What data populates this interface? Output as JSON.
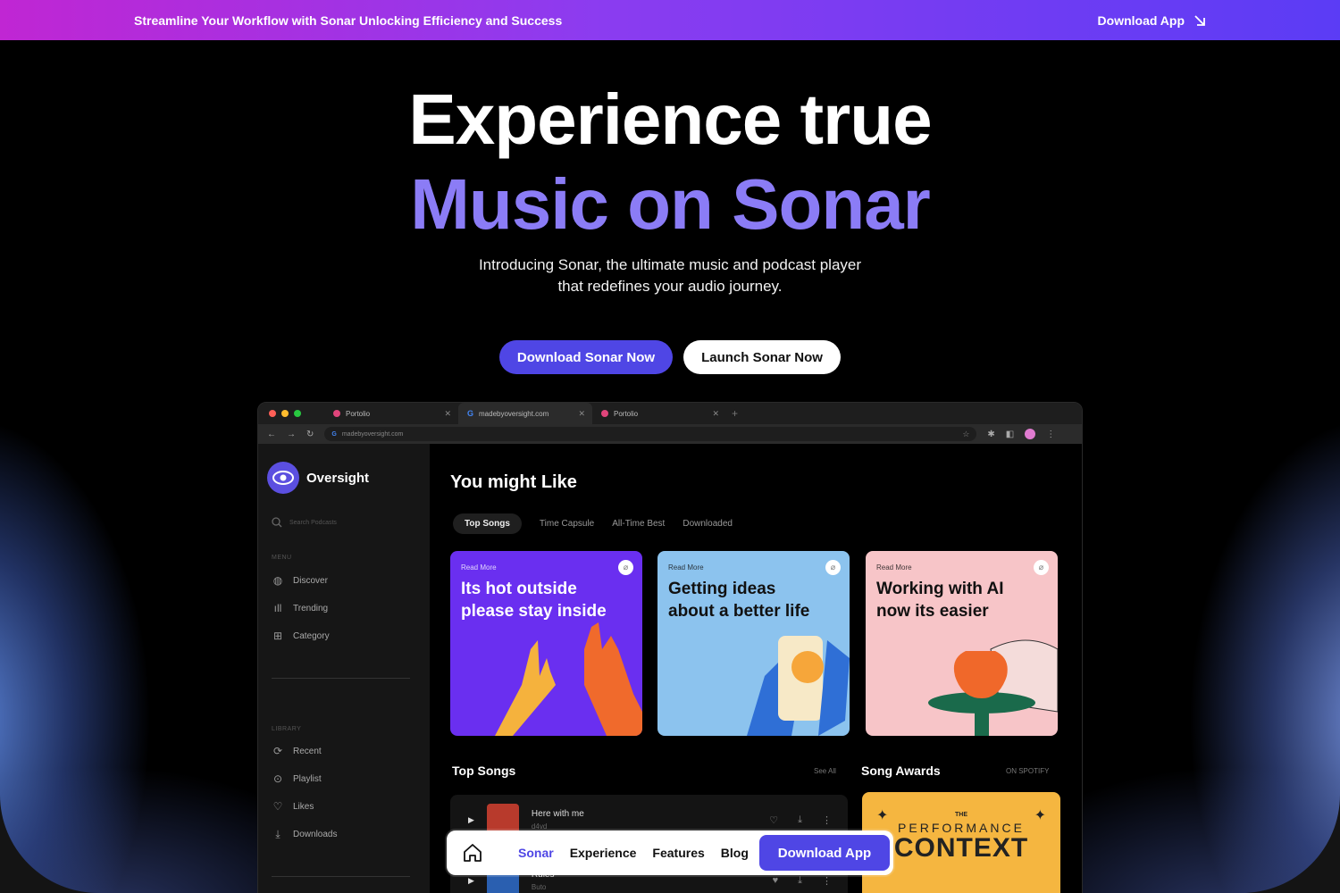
{
  "announcement": {
    "text": "Streamline Your Workflow with Sonar Unlocking Efficiency and Success",
    "link_label": "Download App"
  },
  "hero": {
    "line1": "Experience true",
    "line2": "Music on Sonar",
    "subtitle_line1": "Introducing Sonar, the ultimate music and podcast player",
    "subtitle_line2": "that redefines your audio journey.",
    "primary_cta": "Download Sonar Now",
    "secondary_cta": "Launch Sonar Now"
  },
  "browser": {
    "tabs": [
      {
        "label": "Portolio"
      },
      {
        "label": "madebyoversight.com"
      },
      {
        "label": "Portolio"
      }
    ],
    "url": "madebyoversight.com"
  },
  "app": {
    "brand": "Oversight",
    "search_placeholder": "Search Podcasts",
    "menu_label": "MENU",
    "menu": [
      {
        "label": "Discover",
        "icon": "globe-icon"
      },
      {
        "label": "Trending",
        "icon": "bars-icon"
      },
      {
        "label": "Category",
        "icon": "grid-icon"
      }
    ],
    "library_label": "LIBRARY",
    "library": [
      {
        "label": "Recent",
        "icon": "refresh-icon"
      },
      {
        "label": "Playlist",
        "icon": "play-circle-icon"
      },
      {
        "label": "Likes",
        "icon": "heart-icon"
      },
      {
        "label": "Downloads",
        "icon": "download-icon"
      }
    ],
    "main_title": "You might Like",
    "filters": [
      "Top Songs",
      "Time Capsule",
      "All-Time Best",
      "Downloaded"
    ],
    "cards": [
      {
        "read": "Read More",
        "title": "Its hot outside please stay inside",
        "bg": "#6a2ff0",
        "fg": "#ffffff"
      },
      {
        "read": "Read More",
        "title": "Getting ideas about a better life",
        "bg": "#8cc3ee",
        "fg": "#111111"
      },
      {
        "read": "Read More",
        "title": "Working with AI now its easier",
        "bg": "#f7c5c8",
        "fg": "#111111"
      }
    ],
    "top_songs_title": "Top Songs",
    "see_all": "See All",
    "awards_title": "Song Awards",
    "awards_source": "ON SPOTIFY",
    "songs": [
      {
        "name": "Here with me",
        "artist": "d4vd"
      },
      {
        "name": "Rules",
        "artist": "Buto"
      }
    ],
    "award_card": {
      "small": "THE",
      "line1": "PERFORMANCE",
      "line2": "CONTEXT"
    }
  },
  "floating_nav": {
    "links": [
      "Sonar",
      "Experience",
      "Features",
      "Blog"
    ],
    "active": "Sonar",
    "cta": "Download App"
  },
  "colors": {
    "accent": "#4f46e5",
    "hero_accent": "#8b7cf6"
  }
}
